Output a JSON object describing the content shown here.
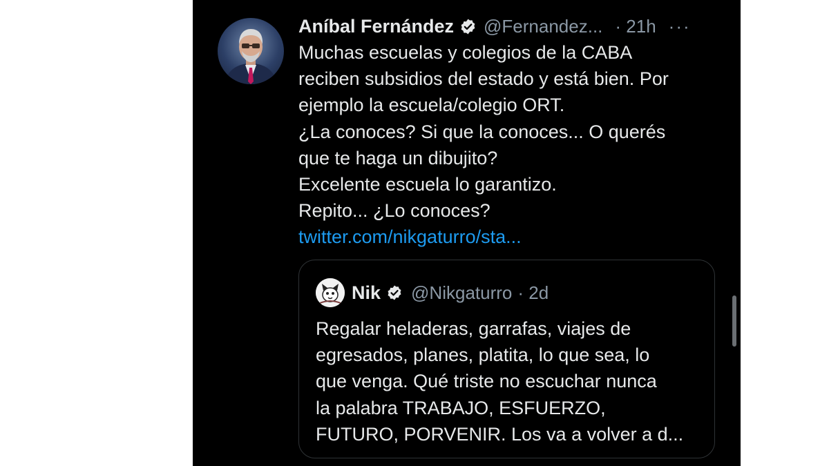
{
  "tweet": {
    "author_name": "Aníbal Fernández",
    "author_handle": "@Fernandez...",
    "time": "· 21h",
    "more": "···",
    "lines": [
      "Muchas escuelas y colegios de la CABA",
      "reciben subsidios del estado y está bien. Por",
      "ejemplo la escuela/colegio ORT.",
      "¿La conoces? Si que la conoces... O querés",
      "que te haga un dibujito?",
      "Excelente escuela lo garantizo.",
      "Repito... ¿Lo conoces?"
    ],
    "link": "twitter.com/nikgaturro/sta..."
  },
  "quoted": {
    "author_name": "Nik",
    "author_handle": "@Nikgaturro",
    "time": "· 2d",
    "lines": [
      "Regalar heladeras, garrafas, viajes de",
      "egresados, planes, platita, lo que sea, lo",
      "que venga. Qué triste no escuchar nunca",
      "la palabra TRABAJO, ESFUERZO,",
      "FUTURO, PORVENIR. Los va a volver a d..."
    ]
  },
  "icons": {
    "verified": "verified-badge-icon",
    "more": "more-icon"
  },
  "colors": {
    "background": "#000000",
    "text": "#e7e9ea",
    "secondary": "#8b98a5",
    "link": "#1d9bf0"
  }
}
